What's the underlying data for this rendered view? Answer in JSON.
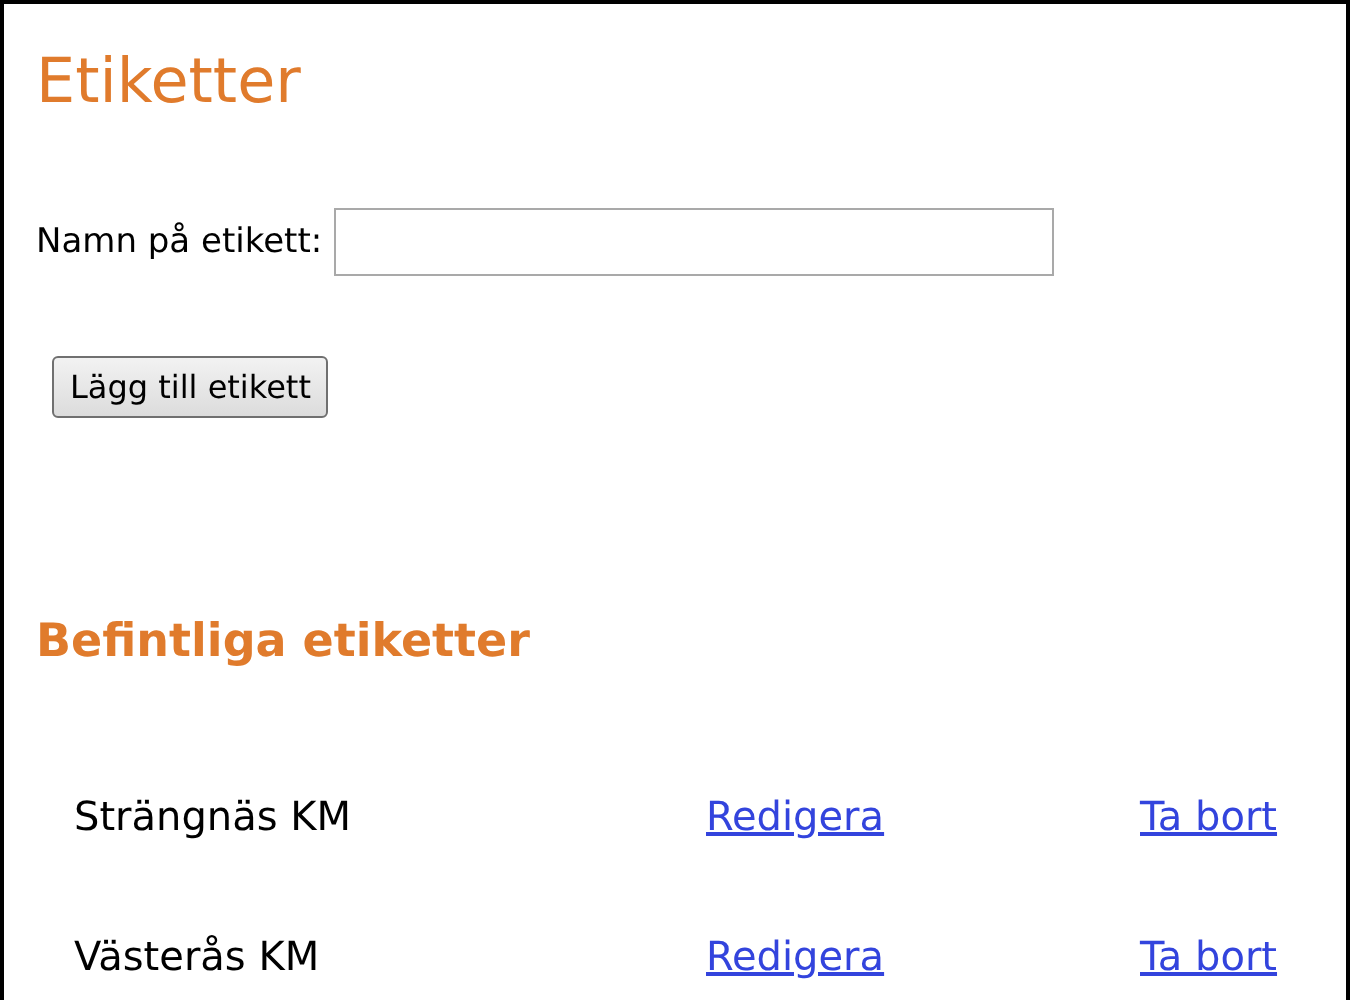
{
  "title": "Etiketter",
  "form": {
    "label": "Namn på etikett:",
    "button": "Lägg till etikett"
  },
  "list_heading": "Befintliga etiketter",
  "labels": [
    {
      "name": "Strängnäs KM",
      "edit": "Redigera",
      "delete": "Ta bort"
    },
    {
      "name": "Västerås KM",
      "edit": "Redigera",
      "delete": "Ta bort"
    }
  ]
}
